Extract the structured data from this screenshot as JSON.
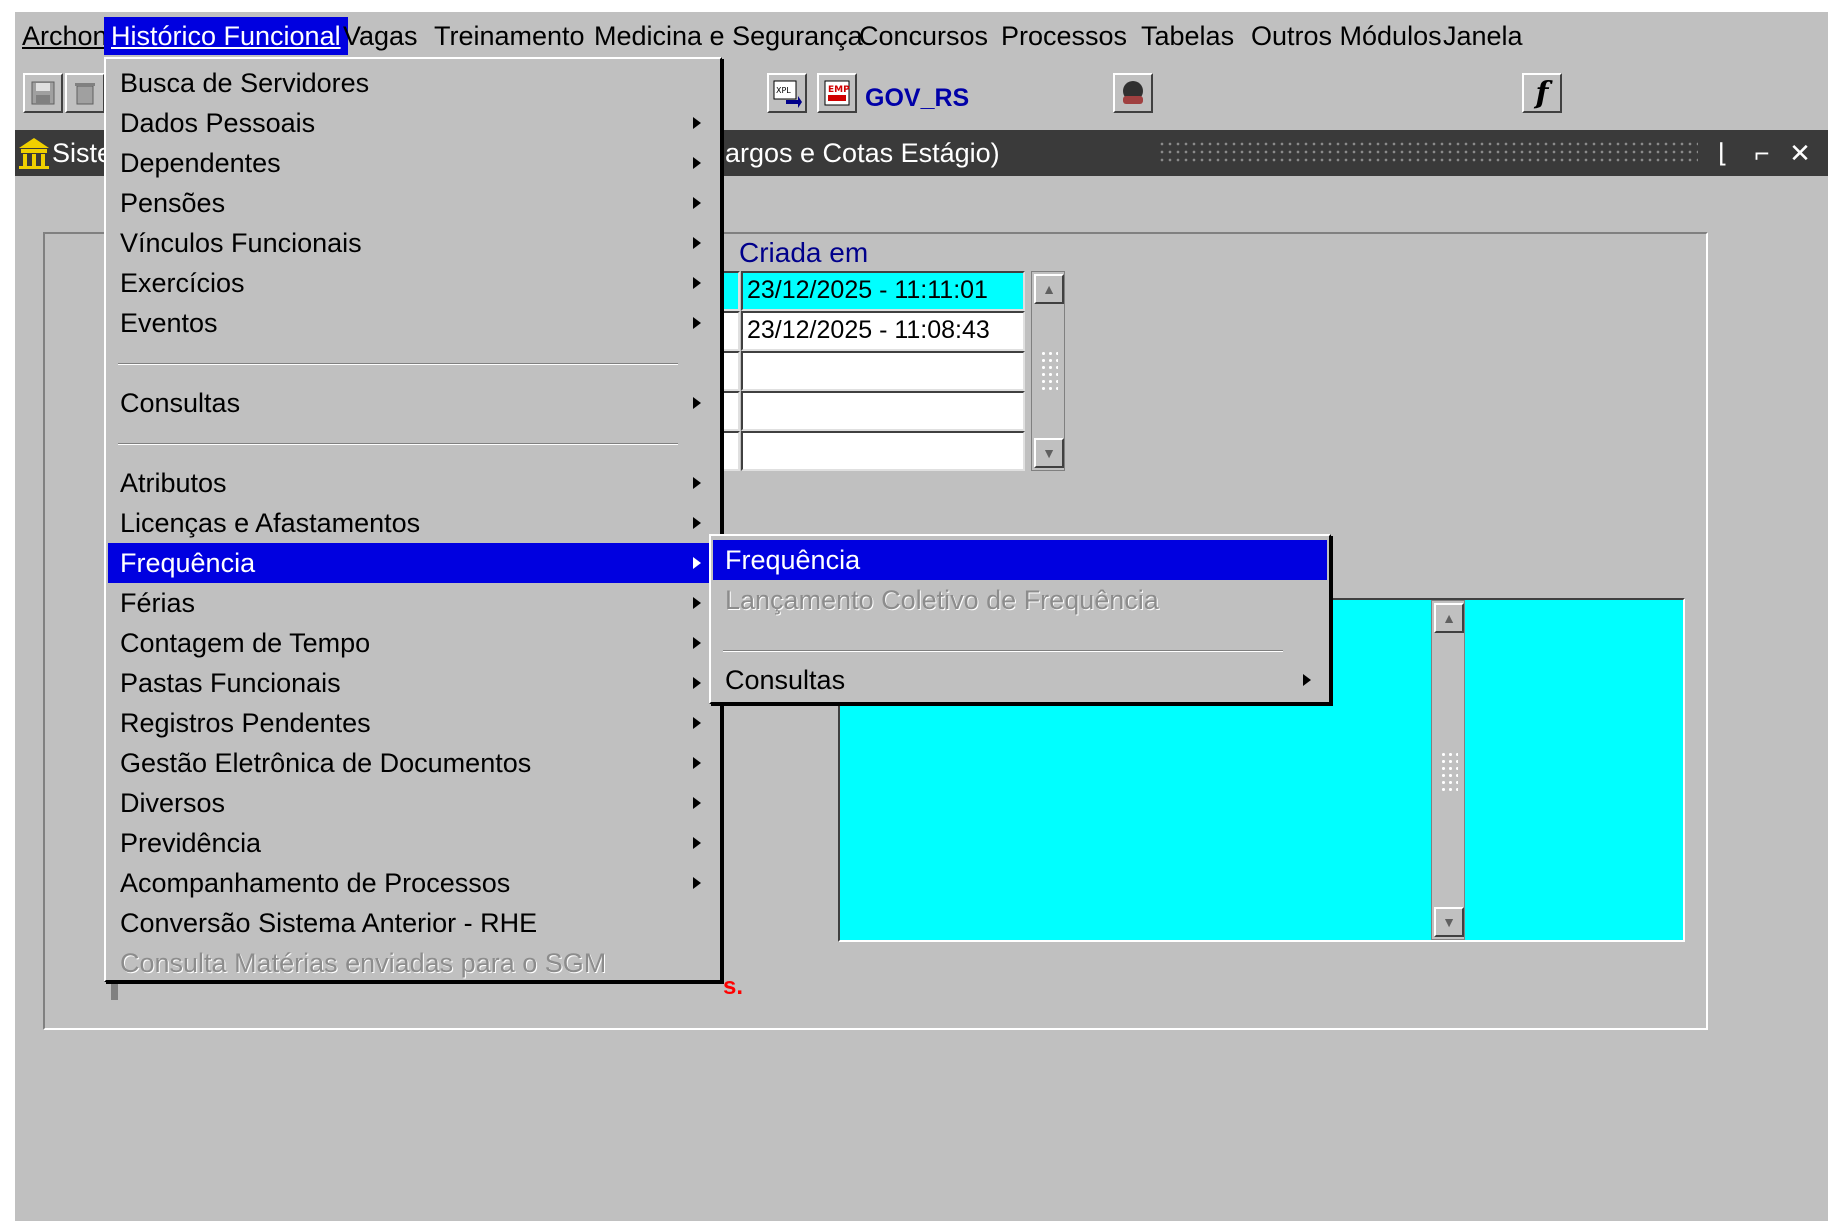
{
  "menubar": {
    "items": [
      {
        "label": "Archon",
        "active": false
      },
      {
        "label": "Histórico Funcional",
        "active": true
      },
      {
        "label": "Vagas",
        "active": false
      },
      {
        "label": "Treinamento",
        "active": false
      },
      {
        "label": "Medicina e Segurança",
        "active": false
      },
      {
        "label": "Concursos",
        "active": false
      },
      {
        "label": "Processos",
        "active": false
      },
      {
        "label": "Tabelas",
        "active": false
      },
      {
        "label": "Outros Módulos",
        "active": false
      },
      {
        "label": "Janela",
        "active": false
      }
    ]
  },
  "toolbar": {
    "org_label": "GOV_RS",
    "icons": [
      "save-icon",
      "delete-icon",
      "excel-export-icon",
      "employer-icon",
      "user-icon",
      "function-icon"
    ]
  },
  "window": {
    "title_left": "Siste",
    "title_right": "argos e Cotas Estágio)"
  },
  "form": {
    "created_label": "Criada em",
    "rows": [
      {
        "created": "23/12/2025  -  11:11:01",
        "selected": true
      },
      {
        "created": "23/12/2025  -  11:08:43",
        "selected": false
      },
      {
        "created": "",
        "selected": false
      },
      {
        "created": "",
        "selected": false
      },
      {
        "created": "",
        "selected": false
      }
    ],
    "partial_red_text": "s."
  },
  "main_menu": {
    "items": [
      {
        "label": "Busca de Servidores",
        "submenu": false,
        "state": "normal"
      },
      {
        "label": "Dados Pessoais",
        "submenu": true,
        "state": "normal"
      },
      {
        "label": "Dependentes",
        "submenu": true,
        "state": "normal"
      },
      {
        "label": "Pensões",
        "submenu": true,
        "state": "normal"
      },
      {
        "label": "Vínculos Funcionais",
        "submenu": true,
        "state": "normal"
      },
      {
        "label": "Exercícios",
        "submenu": true,
        "state": "normal"
      },
      {
        "label": "Eventos",
        "submenu": true,
        "state": "normal"
      },
      {
        "separator": true
      },
      {
        "label": "Consultas",
        "submenu": true,
        "state": "normal"
      },
      {
        "separator": true
      },
      {
        "label": "Atributos",
        "submenu": true,
        "state": "normal"
      },
      {
        "label": "Licenças e Afastamentos",
        "submenu": true,
        "state": "normal"
      },
      {
        "label": "Frequência",
        "submenu": true,
        "state": "selected"
      },
      {
        "label": "Férias",
        "submenu": true,
        "state": "normal"
      },
      {
        "label": "Contagem de Tempo",
        "submenu": true,
        "state": "normal"
      },
      {
        "label": "Pastas Funcionais",
        "submenu": true,
        "state": "normal"
      },
      {
        "label": "Registros Pendentes",
        "submenu": true,
        "state": "normal"
      },
      {
        "label": "Gestão Eletrônica de Documentos",
        "submenu": true,
        "state": "normal"
      },
      {
        "label": "Diversos",
        "submenu": true,
        "state": "normal"
      },
      {
        "label": "Previdência",
        "submenu": true,
        "state": "normal"
      },
      {
        "label": "Acompanhamento de Processos",
        "submenu": true,
        "state": "normal"
      },
      {
        "label": "Conversão Sistema Anterior - RHE",
        "submenu": false,
        "state": "normal"
      },
      {
        "label": "Consulta Matérias enviadas para o SGM",
        "submenu": false,
        "state": "disabled"
      }
    ]
  },
  "sub_menu": {
    "items": [
      {
        "label": "Frequência",
        "submenu": false,
        "state": "selected"
      },
      {
        "label": "Lançamento Coletivo de Frequência",
        "submenu": false,
        "state": "disabled"
      },
      {
        "separator": true
      },
      {
        "label": "Consultas",
        "submenu": true,
        "state": "normal"
      }
    ]
  },
  "colors": {
    "menu_bg": "#c0c0c0",
    "highlight": "#0000e0",
    "field_selected": "#00ffff",
    "label_blue": "#00008b",
    "alert_red": "#ff0000"
  }
}
